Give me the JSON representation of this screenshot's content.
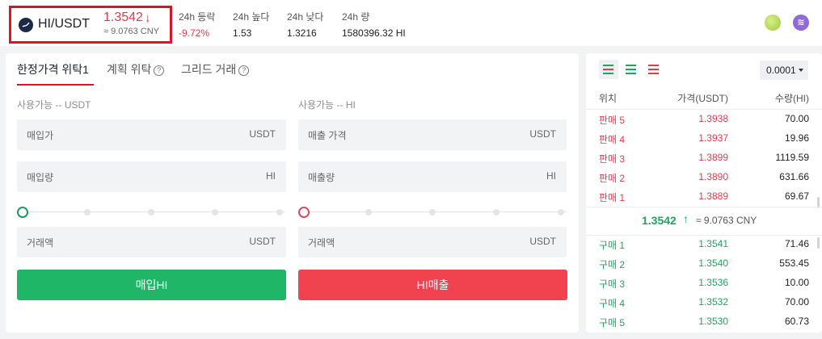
{
  "ticker": {
    "pair": "HI/USDT",
    "price": "1.3542",
    "price_arrow": "↓",
    "cny": "≈ 9.0763 CNY",
    "stats": [
      {
        "label": "24h 등락",
        "value": "-9.72%"
      },
      {
        "label": "24h 높다",
        "value": "1.53"
      },
      {
        "label": "24h 낮다",
        "value": "1.3216"
      },
      {
        "label": "24h 량",
        "value": "1580396.32 HI"
      }
    ],
    "icons": [
      "leaf-icon",
      "exchange-logo-icon"
    ]
  },
  "order_panel": {
    "tabs": [
      "한정가격 위탁1",
      "계획 위탁",
      "그리드 거래"
    ],
    "buy": {
      "available": "사용가능 -- USDT",
      "price_placeholder": "매입가",
      "price_unit": "USDT",
      "amount_placeholder": "매입량",
      "amount_unit": "HI",
      "total_placeholder": "거래액",
      "total_unit": "USDT",
      "button": "매입HI"
    },
    "sell": {
      "available": "사용가능 -- HI",
      "price_placeholder": "매출 가격",
      "price_unit": "USDT",
      "amount_placeholder": "매출량",
      "amount_unit": "HI",
      "total_placeholder": "거래액",
      "total_unit": "USDT",
      "button": "HI매출"
    }
  },
  "order_book": {
    "precision": "0.0001",
    "headers": {
      "position": "위치",
      "price": "가격(USDT)",
      "qty": "수량(HI)"
    },
    "asks": [
      {
        "pos": "판매 5",
        "price": "1.3938",
        "qty": "70.00"
      },
      {
        "pos": "판매 4",
        "price": "1.3937",
        "qty": "19.96"
      },
      {
        "pos": "판매 3",
        "price": "1.3899",
        "qty": "1119.59"
      },
      {
        "pos": "판매 2",
        "price": "1.3890",
        "qty": "631.66"
      },
      {
        "pos": "판매 1",
        "price": "1.3889",
        "qty": "69.67"
      }
    ],
    "mid": {
      "price": "1.3542",
      "arrow": "↑",
      "cny": "≈ 9.0763 CNY"
    },
    "bids": [
      {
        "pos": "구매 1",
        "price": "1.3541",
        "qty": "71.46"
      },
      {
        "pos": "구매 2",
        "price": "1.3540",
        "qty": "553.45"
      },
      {
        "pos": "구매 3",
        "price": "1.3536",
        "qty": "10.00"
      },
      {
        "pos": "구매 4",
        "price": "1.3532",
        "qty": "70.00"
      },
      {
        "pos": "구매 5",
        "price": "1.3530",
        "qty": "60.73"
      }
    ]
  },
  "colors": {
    "sell": "#f0364a",
    "buy": "#1aa85c",
    "highlight_border": "#e0112b"
  }
}
